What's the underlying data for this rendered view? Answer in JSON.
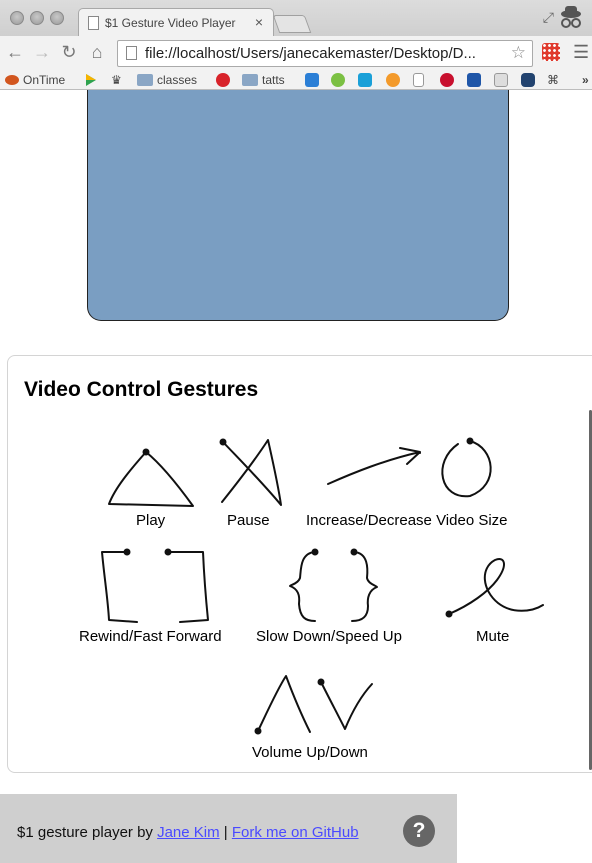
{
  "browser": {
    "tab_title": "$1 Gesture Video Player",
    "tab_close": "×",
    "url": "file://localhost/Users/janecakemaster/Desktop/D...",
    "bookmarks": [
      {
        "label": "OnTime"
      },
      {
        "label": "classes"
      },
      {
        "label": "tatts"
      }
    ]
  },
  "panel": {
    "title": "Video Control Gestures",
    "gestures": [
      {
        "label": "Play",
        "icon": "triangle-gesture-icon"
      },
      {
        "label": "Pause",
        "icon": "x-gesture-icon"
      },
      {
        "label": "Increase/Decrease Video Size",
        "icon": "arrow-circle-gesture-icon"
      },
      {
        "label": "Rewind/Fast Forward",
        "icon": "bracket-gesture-icon"
      },
      {
        "label": "Slow Down/Speed Up",
        "icon": "brace-gesture-icon"
      },
      {
        "label": "Mute",
        "icon": "loop-gesture-icon"
      },
      {
        "label": "Volume Up/Down",
        "icon": "caret-gesture-icon"
      }
    ]
  },
  "footer": {
    "prefix": "$1 gesture player by ",
    "author_link": "Jane Kim",
    "separator": " | ",
    "github_link": "Fork me on GitHub",
    "help_glyph": "?"
  },
  "colors": {
    "video_bg": "#7a9ec2",
    "footer_bg": "#cfcfcf",
    "link": "#4a4aff"
  }
}
